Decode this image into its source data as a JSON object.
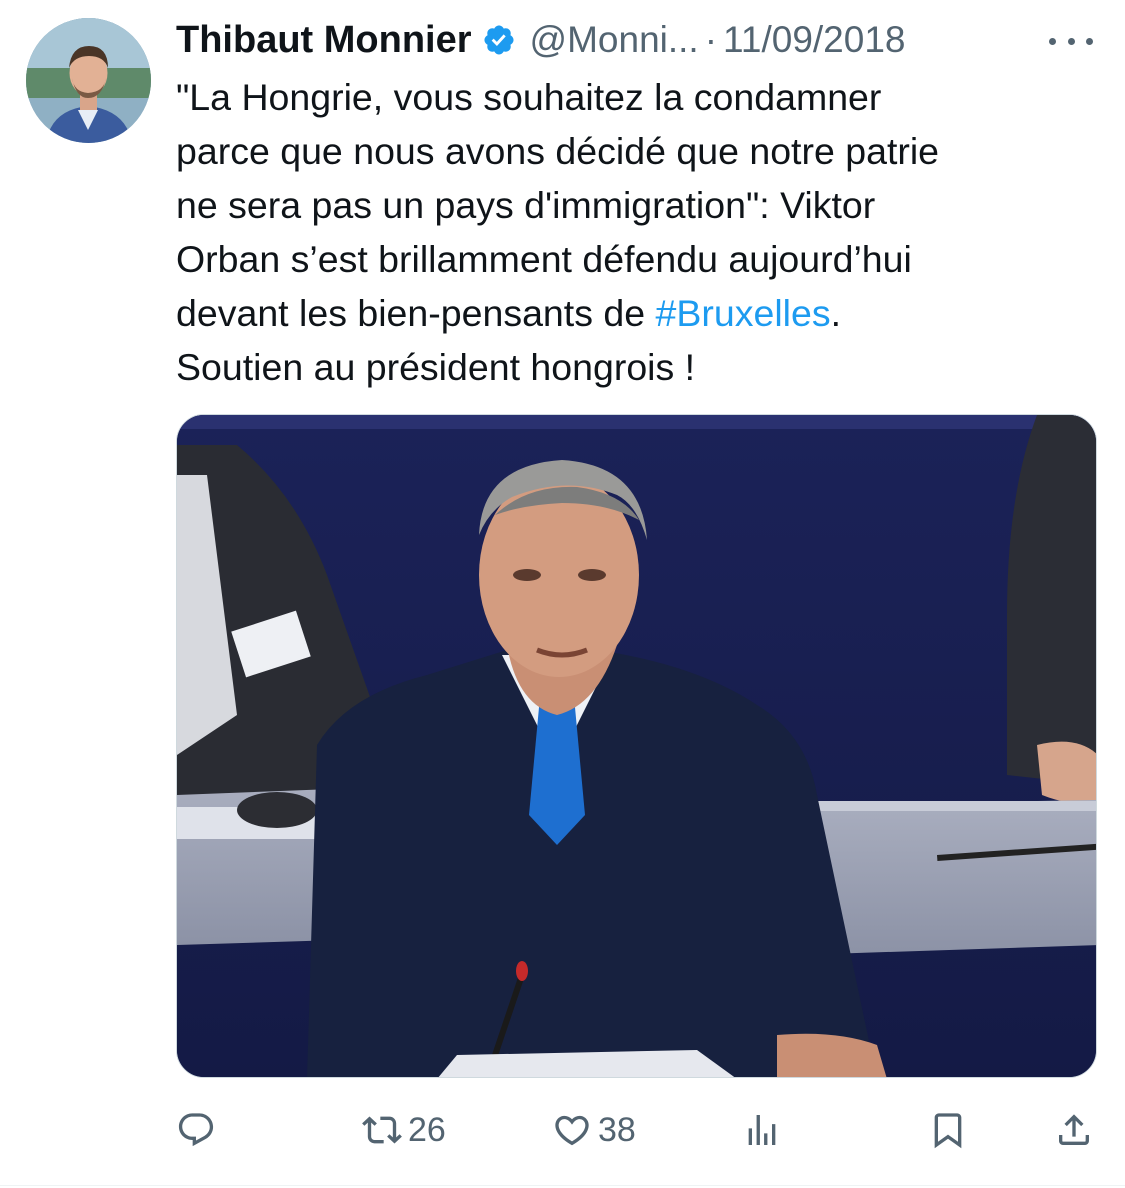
{
  "tweet": {
    "author": {
      "name": "Thibaut Monnier",
      "handle": "@Monni...",
      "verified": true,
      "verified_color": "#1d9bf0"
    },
    "separator": "·",
    "date": "11/09/2018",
    "text_lines": [
      "\"La Hongrie, vous souhaitez la condamner",
      "parce que nous avons décidé que notre patrie",
      "ne sera pas un pays d'immigration\": Viktor",
      "Orban s’est brillamment défendu aujourd’hui"
    ],
    "line5_prefix": "devant les bien-pensants de ",
    "hashtag": "#Bruxelles",
    "line5_suffix": ".",
    "line6": "Soutien au président hongrois !",
    "hashtag_color": "#1d9bf0",
    "media": {
      "kind": "photo",
      "icon": "photo-man-speaking-at-parliament-microphone"
    },
    "actions": {
      "reply_count": "",
      "retweet_count": "26",
      "like_count": "38",
      "views_count": "",
      "reply_icon": "reply-icon",
      "retweet_icon": "retweet-icon",
      "like_icon": "heart-icon",
      "views_icon": "views-icon",
      "bookmark_icon": "bookmark-icon",
      "share_icon": "share-icon"
    },
    "colors": {
      "text": "#0f1419",
      "secondary": "#536471",
      "accent": "#1d9bf0"
    }
  }
}
